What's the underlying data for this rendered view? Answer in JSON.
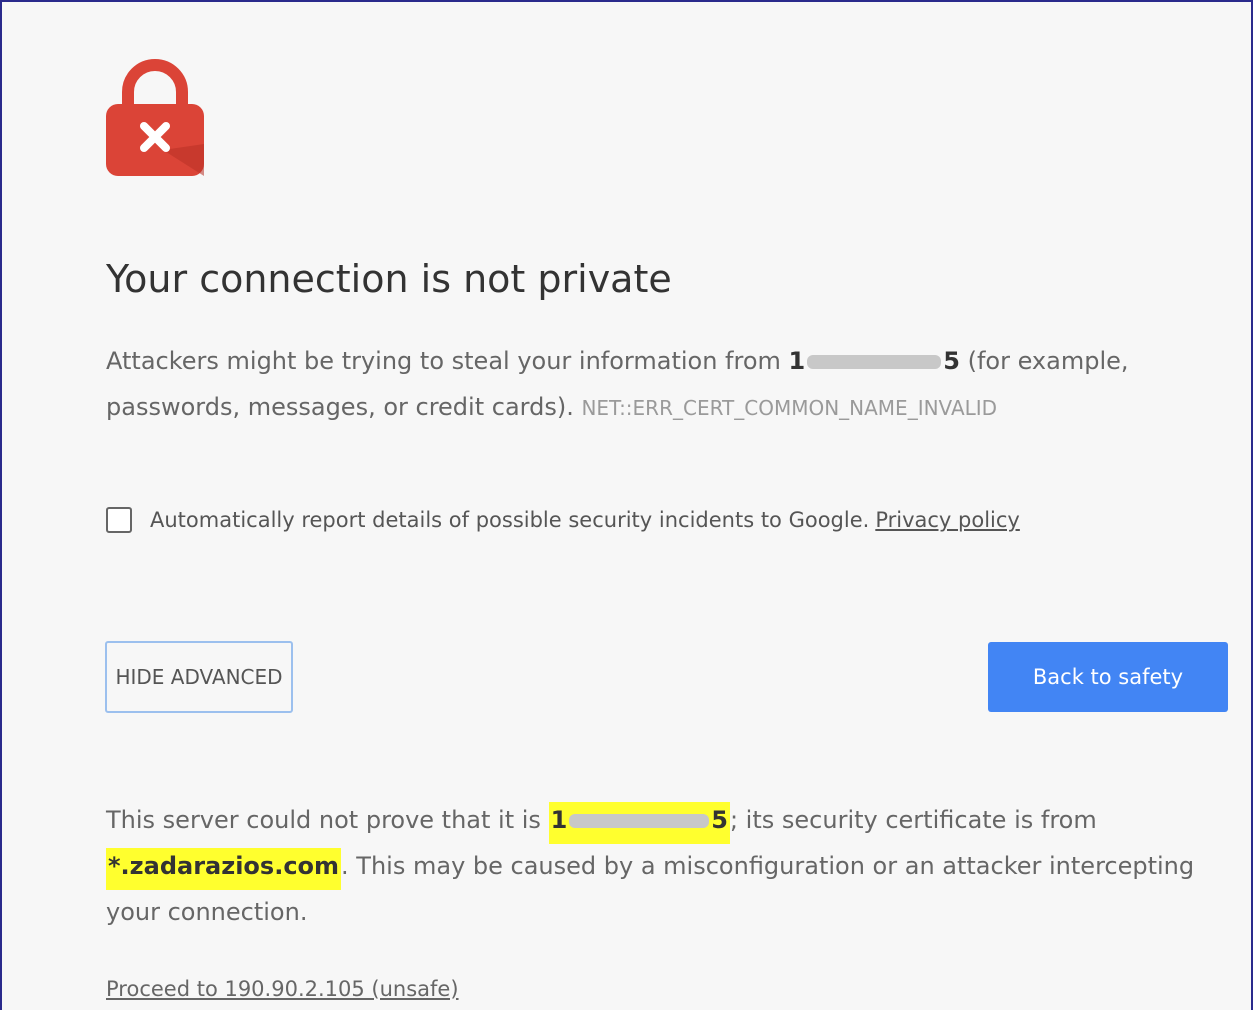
{
  "page": {
    "title": "Your connection is not private",
    "icon": "lock-error-icon",
    "colors": {
      "lock": "#db4437",
      "primary_button": "#4285f4",
      "highlight": "#ffff2e"
    }
  },
  "intro": {
    "text_before": "Attackers might be trying to steal your information from ",
    "host_start": "1",
    "host_end": "5",
    "text_after": " (for example, passwords, messages, or credit cards). ",
    "error_code": "NET::ERR_CERT_COMMON_NAME_INVALID"
  },
  "report": {
    "checked": false,
    "label": "Automatically report details of possible security incidents to Google.",
    "privacy_link": "Privacy policy"
  },
  "buttons": {
    "hide_advanced": "HIDE ADVANCED",
    "back_to_safety": "Back to safety"
  },
  "advanced": {
    "text_before": "This server could not prove that it is ",
    "host_start": "1",
    "host_end": "5",
    "text_middle": "; its security certificate is from ",
    "cert_domain": "*.zadarazios.com",
    "text_after": ". This may be caused by a misconfiguration or an attacker intercepting your connection.",
    "proceed_link": "Proceed to 190.90.2.105 (unsafe)"
  }
}
